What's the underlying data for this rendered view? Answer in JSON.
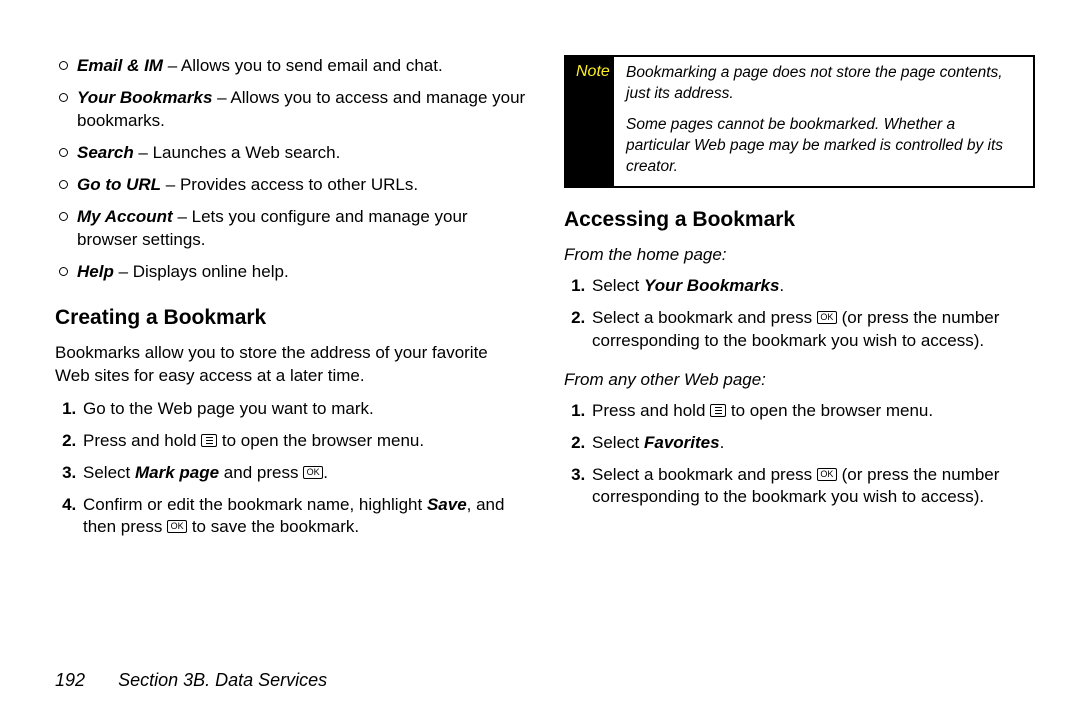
{
  "left": {
    "bullets": [
      {
        "term": "Email & IM",
        "desc": " – Allows you to send email and chat."
      },
      {
        "term": "Your Bookmarks",
        "desc": " – Allows you to access and manage your bookmarks."
      },
      {
        "term": "Search",
        "desc": " – Launches a Web search."
      },
      {
        "term": "Go to URL",
        "desc": " – Provides access to other URLs."
      },
      {
        "term": "My Account",
        "desc": " – Lets you configure and manage your browser settings."
      },
      {
        "term": "Help",
        "desc": " – Displays online help."
      }
    ],
    "heading": "Creating a Bookmark",
    "intro": "Bookmarks allow you to store the address of your favorite Web sites for easy access at a later time.",
    "step1": "Go to the Web page you want to mark.",
    "step2a": "Press and hold ",
    "step2b": " to open the browser menu.",
    "step3a": "Select ",
    "step3_bold": "Mark page",
    "step3b": " and press ",
    "step3c": ".",
    "step4a": "Confirm or edit the bookmark name, highlight ",
    "step4_save": "Save",
    "step4b": ", and then press ",
    "step4c": " to save the bookmark."
  },
  "right": {
    "note_label": "Note",
    "note_p1": "Bookmarking a page does not store the page contents, just its address.",
    "note_p2": "Some pages cannot be bookmarked. Whether a particular Web page may be marked is controlled by its creator.",
    "heading": "Accessing a Bookmark",
    "sub1": "From the home page:",
    "a1a": "Select ",
    "a1_bold": "Your Bookmarks",
    "a1b": ".",
    "a2a": "Select a bookmark and press ",
    "a2b": " (or press the number corresponding to the bookmark you wish to access).",
    "sub2": "From any other Web page:",
    "b1a": "Press and hold ",
    "b1b": " to open the browser menu.",
    "b2a": "Select ",
    "b2_bold": "Favorites",
    "b2b": ".",
    "b3a": "Select a bookmark and press ",
    "b3b": " (or press the number corresponding to the bookmark you wish to access)."
  },
  "footer": {
    "page": "192",
    "section": "Section 3B. Data Services"
  },
  "keys": {
    "ok": "OK"
  }
}
